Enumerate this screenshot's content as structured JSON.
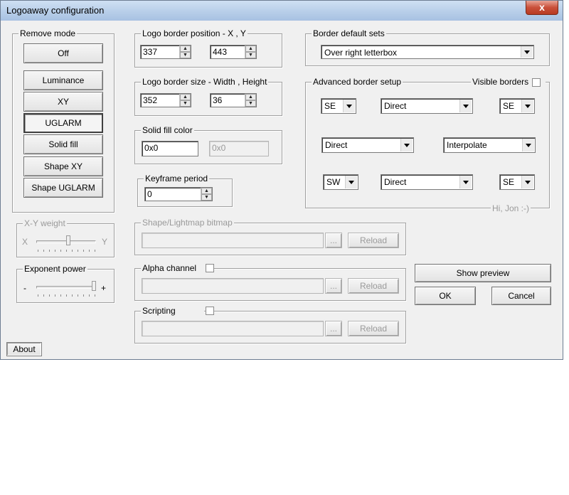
{
  "window": {
    "title": "Logoaway configuration",
    "close_glyph": "x"
  },
  "remove_mode": {
    "label": "Remove mode",
    "buttons": [
      "Off",
      "Luminance",
      "XY",
      "UGLARM",
      "Solid fill",
      "Shape XY",
      "Shape UGLARM"
    ],
    "selected": "UGLARM"
  },
  "xy_weight": {
    "label": "X-Y weight",
    "left": "X",
    "right": "Y"
  },
  "exponent_power": {
    "label": "Exponent power",
    "left": "-",
    "right": "+"
  },
  "about_label": "About",
  "logo_position": {
    "label": "Logo border position - X , Y",
    "x": "337",
    "y": "443"
  },
  "logo_size": {
    "label": "Logo border size - Width , Height",
    "width": "352",
    "height": "36"
  },
  "solid_fill": {
    "label": "Solid fill color",
    "value1": "0x0",
    "value2": "0x0"
  },
  "keyframe": {
    "label": "Keyframe period",
    "value": "0"
  },
  "shape_bitmap": {
    "label": "Shape/Lightmap bitmap",
    "browse": "...",
    "reload": "Reload"
  },
  "alpha_channel": {
    "label": "Alpha channel",
    "browse": "...",
    "reload": "Reload"
  },
  "scripting": {
    "label": "Scripting",
    "browse": "...",
    "reload": "Reload"
  },
  "border_default": {
    "label": "Border default sets",
    "value": "Over right letterbox"
  },
  "advanced": {
    "label": "Advanced border setup",
    "visible_label": "Visible borders",
    "footer": "Hi, Jon :-)",
    "row1": {
      "corner_left": "SE",
      "mode": "Direct",
      "corner_right": "SE"
    },
    "row2": {
      "left": "Direct",
      "right": "Interpolate"
    },
    "row3": {
      "corner_left": "SW",
      "mode": "Direct",
      "corner_right": "SE"
    }
  },
  "actions": {
    "preview": "Show preview",
    "ok": "OK",
    "cancel": "Cancel"
  }
}
